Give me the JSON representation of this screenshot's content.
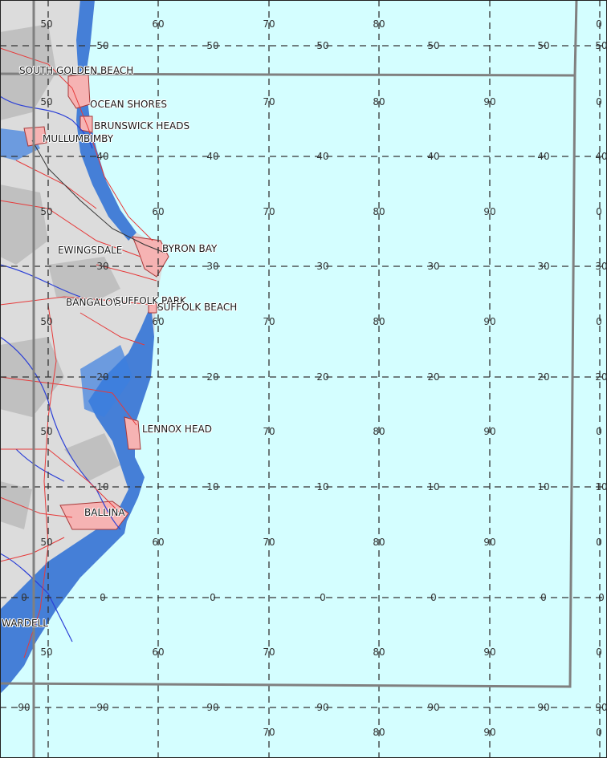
{
  "colors": {
    "sea": "#d4feff",
    "land_light": "#e6e6e6",
    "land_grey": "#bdbdbd",
    "elevation_blue": "#2a6fd6",
    "town_fill": "#f6b3b3",
    "road": "#e63a3a",
    "river": "#2b3fd6",
    "boundary": "#808080",
    "grid": "#333333"
  },
  "places": [
    {
      "name": "SOUTH GOLDEN BEACH"
    },
    {
      "name": "OCEAN SHORES"
    },
    {
      "name": "BRUNSWICK HEADS"
    },
    {
      "name": "MULLUMBIMBY"
    },
    {
      "name": "EWINGSDALE"
    },
    {
      "name": "BYRON BAY"
    },
    {
      "name": "BANGALOW"
    },
    {
      "name": "SUFFOLK PARK"
    },
    {
      "name": "SUFFOLK BEACH"
    },
    {
      "name": "LENNOX HEAD"
    },
    {
      "name": "BALLINA"
    },
    {
      "name": "WARDELL"
    }
  ],
  "grid_labels": [
    "50",
    "60",
    "70",
    "80",
    "0",
    "50",
    "50",
    "50",
    "50",
    "50",
    "50",
    "50",
    "70",
    "80",
    "90",
    "0",
    "40",
    "40",
    "40",
    "40",
    "40",
    "40",
    "50",
    "60",
    "70",
    "80",
    "90",
    "0",
    "30",
    "30",
    "30",
    "30",
    "30",
    "30",
    "50",
    "60",
    "70",
    "80",
    "90",
    "0",
    "20",
    "20",
    "20",
    "20",
    "20",
    "20",
    "50",
    "70",
    "80",
    "90",
    "0",
    "10",
    "10",
    "10",
    "10",
    "10",
    "10",
    "50",
    "60",
    "70",
    "80",
    "90",
    "0",
    "0",
    "0",
    "0",
    "0",
    "0",
    "0",
    "0",
    "50",
    "60",
    "70",
    "80",
    "90",
    "0",
    "90",
    "90",
    "90",
    "90",
    "90",
    "90",
    "90",
    "70",
    "80",
    "90",
    "0"
  ]
}
